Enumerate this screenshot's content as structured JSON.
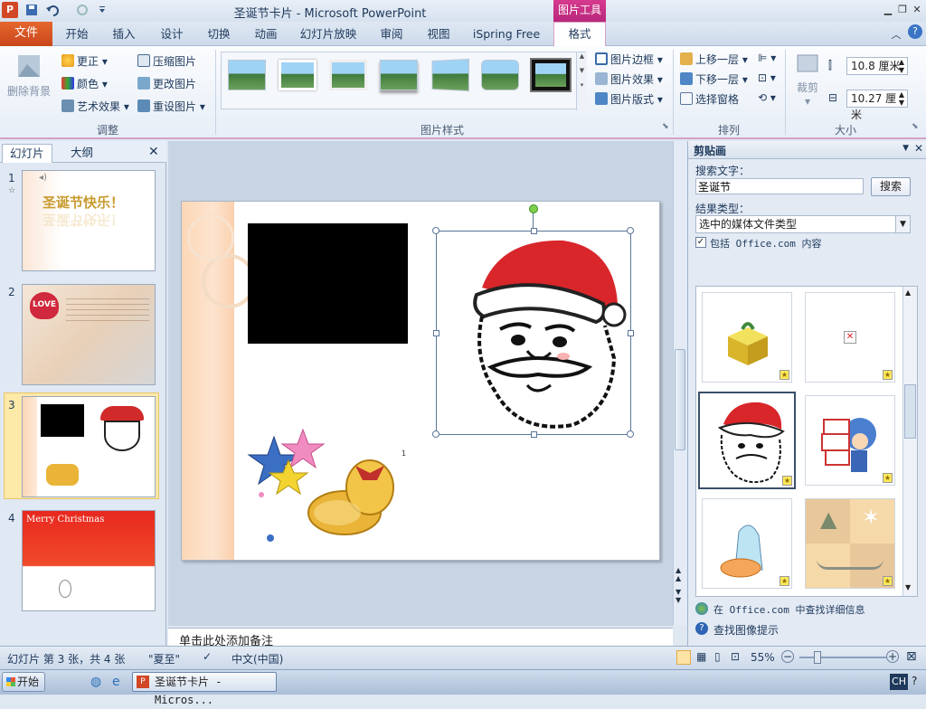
{
  "window": {
    "title": "圣诞节卡片 - Microsoft PowerPoint",
    "context_tool": "图片工具",
    "app_icon": "P"
  },
  "tabs": {
    "file": "文件",
    "items": [
      "开始",
      "插入",
      "设计",
      "切换",
      "动画",
      "幻灯片放映",
      "审阅",
      "视图",
      "iSpring Free"
    ],
    "active": "格式"
  },
  "ribbon": {
    "adjust": {
      "remove_bg": "删除背景",
      "corrections": "更正",
      "color": "颜色",
      "artistic": "艺术效果",
      "compress": "压缩图片",
      "change": "更改图片",
      "reset": "重设图片",
      "label": "调整"
    },
    "styles": {
      "border": "图片边框",
      "effects": "图片效果",
      "layout": "图片版式",
      "label": "图片样式"
    },
    "arrange": {
      "bring_forward": "上移一层",
      "send_backward": "下移一层",
      "selection_pane": "选择窗格",
      "label": "排列"
    },
    "size": {
      "crop": "裁剪",
      "height": "10.8 厘米",
      "width": "10.27 厘米",
      "label": "大小"
    }
  },
  "left_pane": {
    "tab_slides": "幻灯片",
    "tab_outline": "大纲",
    "slides": [
      {
        "num": "1",
        "text": "圣诞节快乐！"
      },
      {
        "num": "2",
        "text": "LOVE"
      },
      {
        "num": "3",
        "text": ""
      },
      {
        "num": "4",
        "text": "Merry Christmas"
      }
    ],
    "selected_index": 3
  },
  "slide": {
    "marker": "1"
  },
  "notes": {
    "placeholder": "单击此处添加备注"
  },
  "clip_pane": {
    "title": "剪贴画",
    "search_label": "搜索文字：",
    "search_value": "圣诞节",
    "search_button": "搜索",
    "result_type_label": "结果类型：",
    "result_type_value": "选中的媒体文件类型",
    "include_office": "包括 Office.com 内容",
    "include_checked": true,
    "link_office": "在 Office.com 中查找详细信息",
    "link_tips": "查找图像提示"
  },
  "statusbar": {
    "slide_info": "幻灯片 第 3 张，共 4 张",
    "theme": "\"夏至\"",
    "language": "中文(中国)",
    "zoom": "55%"
  },
  "taskbar": {
    "start": "开始",
    "task": "圣诞节卡片 - Micros...",
    "ime": "CH"
  },
  "colors": {
    "file_tab": "#d24726",
    "context_tab": "#c62f85",
    "accent": "#1e395b"
  }
}
